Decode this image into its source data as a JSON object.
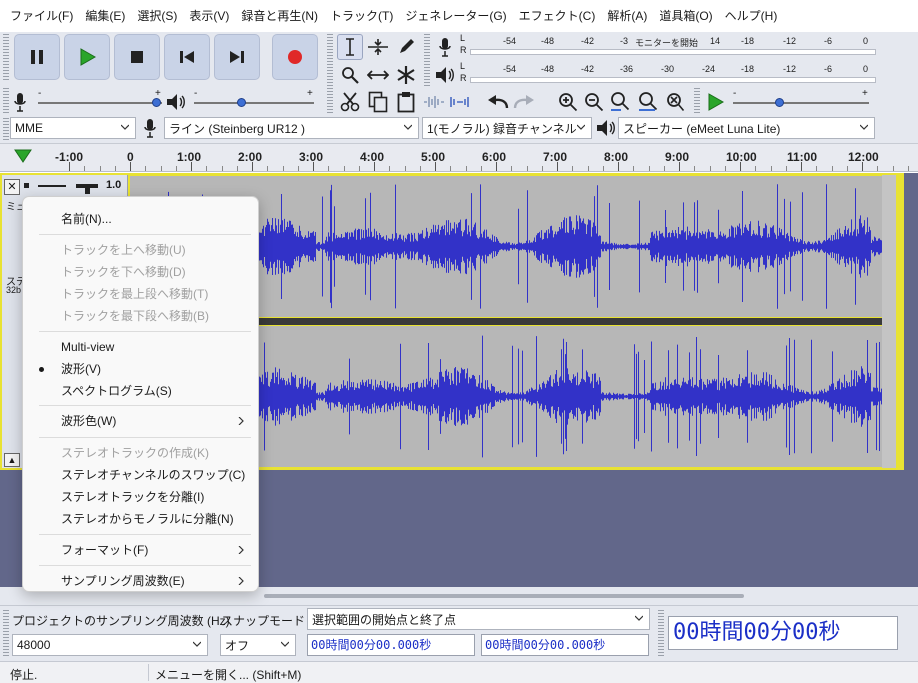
{
  "menubar": [
    "ファイル(F)",
    "編集(E)",
    "選択(S)",
    "表示(V)",
    "録音と再生(N)",
    "トラック(T)",
    "ジェネレーター(G)",
    "エフェクト(C)",
    "解析(A)",
    "道具箱(O)",
    "ヘルプ(H)"
  ],
  "meters": {
    "record_scale": [
      "-54",
      "-48",
      "-42",
      "-3",
      "モニターを開始",
      "14",
      "-18",
      "-12",
      "-6",
      "0"
    ],
    "play_scale": [
      "-54",
      "-48",
      "-42",
      "-36",
      "-30",
      "-24",
      "-18",
      "-12",
      "-6",
      "0"
    ],
    "channel_left": "L",
    "channel_right": "R"
  },
  "sliders": {
    "record_volume_min": "-",
    "record_volume_max": "+",
    "play_volume_min": "-",
    "play_volume_max": "+",
    "playback_speed_min": "-",
    "playback_speed_max": "+"
  },
  "devices": {
    "host": "MME",
    "input": "ライン (Steinberg UR12 )",
    "channels": "1(モノラル) 録音チャンネル",
    "output": "スピーカー (eMeet Luna Lite)"
  },
  "ruler": {
    "labels": [
      "-1:00",
      "0",
      "1:00",
      "2:00",
      "3:00",
      "4:00",
      "5:00",
      "6:00",
      "7:00",
      "8:00",
      "9:00",
      "10:00",
      "11:00",
      "12:00"
    ]
  },
  "track": {
    "gain_value": "1.0",
    "name_fragment": "ミュ",
    "info_line1": "ステ",
    "info_line2": "32b",
    "close_glyph": "✕",
    "collapse_glyph": "▲"
  },
  "context_menu": {
    "items": [
      {
        "label": "名前(N)...",
        "disabled": false
      },
      {
        "label": "トラックを上へ移動(U)",
        "disabled": true
      },
      {
        "label": "トラックを下へ移動(D)",
        "disabled": true
      },
      {
        "label": "トラックを最上段へ移動(T)",
        "disabled": true
      },
      {
        "label": "トラックを最下段へ移動(B)",
        "disabled": true
      },
      {
        "label": "Multi-view",
        "disabled": false
      },
      {
        "label": "波形(V)",
        "disabled": false,
        "checked": true
      },
      {
        "label": "スペクトログラム(S)",
        "disabled": false
      },
      {
        "label": "波形色(W)",
        "disabled": false,
        "submenu": true
      },
      {
        "label": "ステレオトラックの作成(K)",
        "disabled": true
      },
      {
        "label": "ステレオチャンネルのスワップ(C)",
        "disabled": false
      },
      {
        "label": "ステレオトラックを分離(I)",
        "disabled": false
      },
      {
        "label": "ステレオからモノラルに分離(N)",
        "disabled": false
      },
      {
        "label": "フォーマット(F)",
        "disabled": false,
        "submenu": true
      },
      {
        "label": "サンプリング周波数(E)",
        "disabled": false,
        "submenu": true
      }
    ]
  },
  "selection_bar": {
    "rate_label": "プロジェクトのサンプリング周波数 (Hz)",
    "rate_value": "48000",
    "snap_label": "スナップモード",
    "snap_value": "オフ",
    "selection_mode": "選択範囲の開始点と終了点",
    "start_time": "00時間00分00.000秒",
    "end_time": "00時間00分00.000秒",
    "big_time": "00時間00分00秒"
  },
  "status": {
    "state": "停止.",
    "hint": "メニューを開く... (Shift+M)"
  },
  "colors": {
    "waveform": "#3232c8",
    "track_background": "#b7b7b7",
    "selected_border": "#e8e233",
    "time_text": "#1b2fc7",
    "play_green": "#2aa52a",
    "record_red": "#e02828"
  }
}
